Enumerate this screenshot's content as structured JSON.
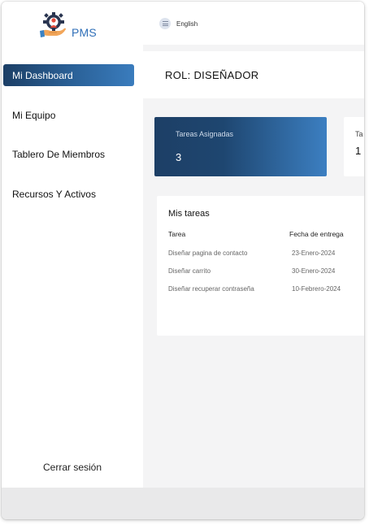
{
  "app": {
    "logo_text": "PMS",
    "logo_icon": "gear-with-hand-person-icon"
  },
  "colors": {
    "accent_dark": "#1c3f66",
    "accent_light": "#3c7fc1",
    "logo_text": "#2f6fb8"
  },
  "sidebar": {
    "items": [
      {
        "label": "Mi Dashboard",
        "active": true
      },
      {
        "label": "Mi Equipo",
        "active": false
      },
      {
        "label": "Tablero De Miembros",
        "active": false
      },
      {
        "label": "Recursos Y Activos",
        "active": false
      }
    ],
    "logout_label": "Cerrar sesión"
  },
  "topbar": {
    "language_label": "English",
    "language_icon": "menu-lines-icon"
  },
  "role": {
    "text": "ROL:  DISEÑADOR"
  },
  "cards": [
    {
      "label": "Tareas Asignadas",
      "value": "3"
    },
    {
      "label": "Ta",
      "value": "1"
    }
  ],
  "tasks": {
    "title": "Mis tareas",
    "headers": [
      "Tarea",
      "Fecha de entrega"
    ],
    "rows": [
      [
        "Diseñar pagina de contacto",
        "23-Enero-2024"
      ],
      [
        "Diseñar carrito",
        "30-Enero-2024"
      ],
      [
        "Diseñar recuperar contraseña",
        "10-Febrero-2024"
      ]
    ]
  }
}
